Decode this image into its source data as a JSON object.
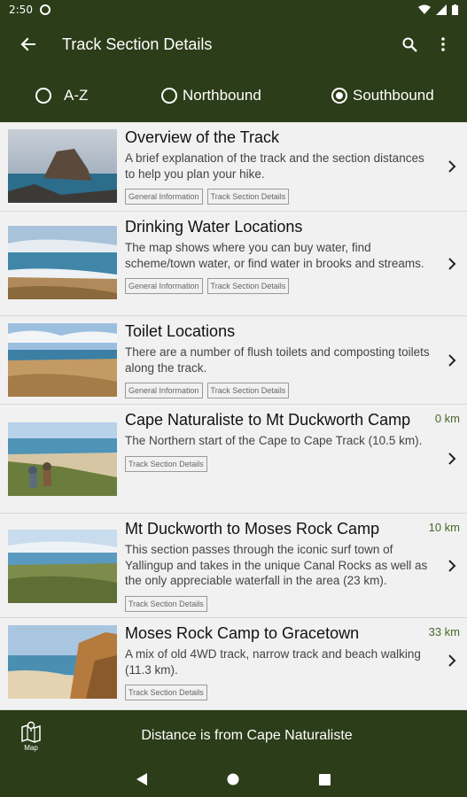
{
  "status": {
    "time": "2:50"
  },
  "appbar": {
    "title": "Track Section Details"
  },
  "sort": {
    "options": [
      {
        "label": "A-Z",
        "selected": false
      },
      {
        "label": "Northbound",
        "selected": false
      },
      {
        "label": "Southbound",
        "selected": true
      }
    ]
  },
  "items": [
    {
      "title": "Overview of the Track",
      "desc": "A brief explanation of the track and the section distances to help you plan your hike.",
      "tags": [
        "General Information",
        "Track Section Details"
      ],
      "distance": ""
    },
    {
      "title": "Drinking Water Locations",
      "desc": "The map shows where you can buy water, find scheme/town water, or find water in brooks and streams.",
      "tags": [
        "General Information",
        "Track Section Details"
      ],
      "distance": ""
    },
    {
      "title": "Toilet Locations",
      "desc": "There are a number of flush toilets and composting toilets along the track.",
      "tags": [
        "General Information",
        "Track Section Details"
      ],
      "distance": ""
    },
    {
      "title": "Cape Naturaliste to Mt Duckworth Camp",
      "desc": "The Northern start of the Cape to Cape Track (10.5 km).",
      "tags": [
        "Track Section Details"
      ],
      "distance": "0 km"
    },
    {
      "title": "Mt Duckworth to Moses Rock Camp",
      "desc": "This section passes through the iconic surf town of Yallingup and takes in the unique Canal Rocks as well as the only appreciable waterfall in the area (23 km).",
      "tags": [
        "Track Section Details"
      ],
      "distance": "10 km"
    },
    {
      "title": "Moses Rock Camp to Gracetown",
      "desc": "A mix of old 4WD track, narrow track and beach walking (11.3 km).",
      "tags": [
        "Track Section Details"
      ],
      "distance": "33 km"
    }
  ],
  "bottom": {
    "map_label": "Map",
    "footer": "Distance is from Cape Naturaliste"
  },
  "colors": {
    "primary": "#2c3d19",
    "distance": "#4a6628"
  }
}
